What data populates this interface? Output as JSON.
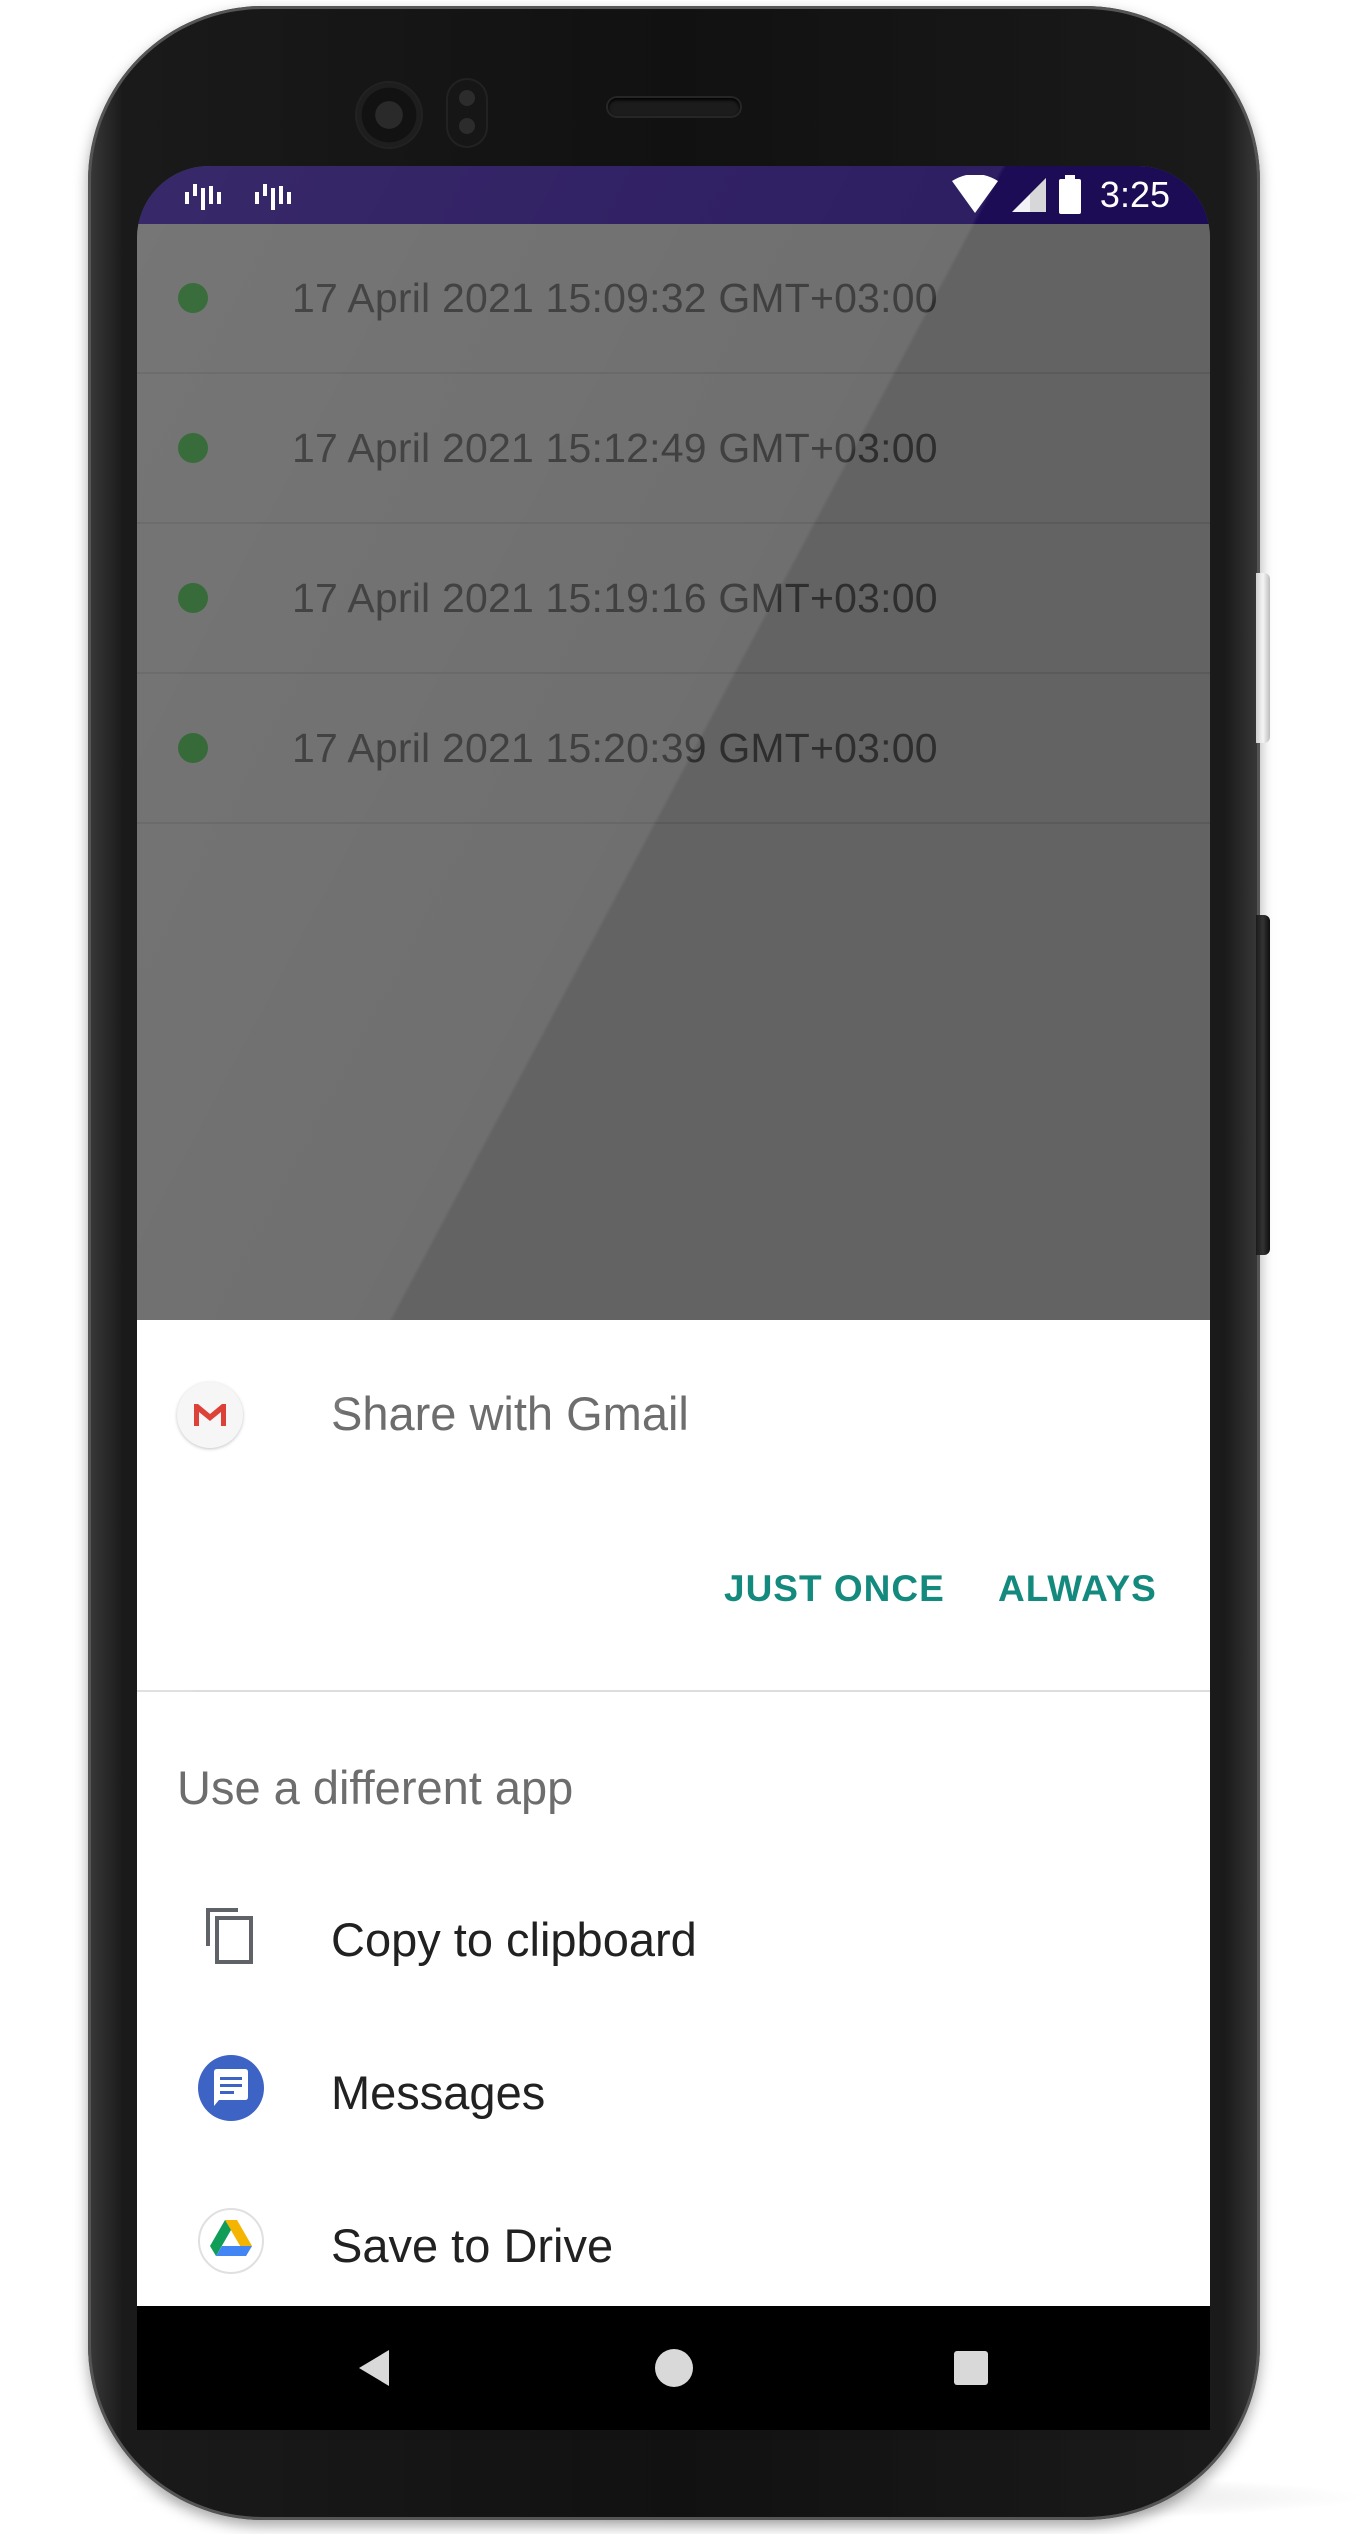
{
  "status_bar": {
    "time": "3:25",
    "notification_icons": [
      "sim-activity-icon",
      "sim-activity-icon"
    ],
    "status_icons": [
      "wifi-icon",
      "cell-signal-icon",
      "battery-icon"
    ],
    "background_color": "#1c0b55"
  },
  "list": {
    "items": [
      {
        "label": "17 April 2021 15:09:32 GMT+03:00",
        "status_color": "#1f5a22"
      },
      {
        "label": "17 April 2021 15:12:49 GMT+03:00",
        "status_color": "#1f5a22"
      },
      {
        "label": "17 April 2021 15:19:16 GMT+03:00",
        "status_color": "#1f5a22"
      },
      {
        "label": "17 April 2021 15:20:39 GMT+03:00",
        "status_color": "#1f5a22"
      }
    ]
  },
  "share_sheet": {
    "title": "Share with Gmail",
    "app_icon": "gmail-icon",
    "buttons": {
      "just_once": "JUST ONCE",
      "always": "ALWAYS"
    },
    "accent_color": "#148a7e",
    "different_app_label": "Use a different app",
    "options": [
      {
        "label": "Copy to clipboard",
        "icon": "copy-icon"
      },
      {
        "label": "Messages",
        "icon": "messages-icon"
      },
      {
        "label": "Save to Drive",
        "icon": "drive-icon"
      }
    ]
  },
  "nav_bar": {
    "buttons": [
      "back-icon",
      "home-icon",
      "recents-icon"
    ]
  }
}
